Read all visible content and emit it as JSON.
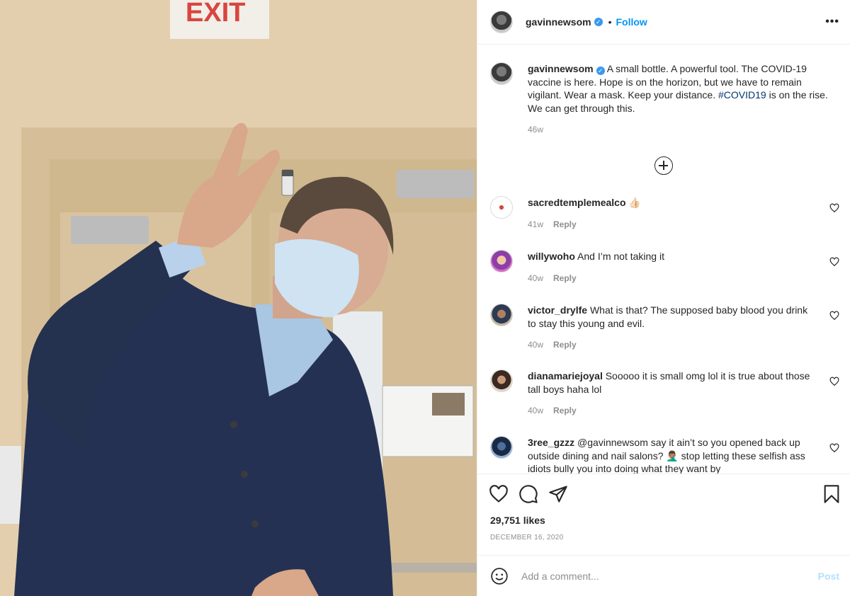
{
  "post": {
    "username": "gavinnewsom",
    "verified": true,
    "follow_label": "Follow",
    "more_label": "•••",
    "dot": "•"
  },
  "photo": {
    "exit_sign_text": "EXIT"
  },
  "caption": {
    "username": "gavinnewsom",
    "text_before": "A small bottle. A powerful tool. The COVID-19 vaccine is here. Hope is on the horizon, but we have to remain vigilant. Wear a mask. Keep your distance. ",
    "hashtag": "#COVID19",
    "text_after": " is on the rise. We can get through this.",
    "time": "46w"
  },
  "comments": [
    {
      "username": "sacredtemplemealco",
      "text": "👍🏻",
      "time": "41w",
      "reply_label": "Reply"
    },
    {
      "username": "willywoho",
      "text": "And I’m not taking it",
      "time": "40w",
      "reply_label": "Reply"
    },
    {
      "username": "victor_drylfe",
      "text": "What is that? The supposed baby blood you drink to stay this young and evil.",
      "time": "40w",
      "reply_label": "Reply"
    },
    {
      "username": "dianamariejoyal",
      "text": "Sooooo it is small omg lol it is true about those tall boys haha lol",
      "time": "40w",
      "reply_label": "Reply"
    },
    {
      "username": "3ree_gzzz",
      "text": "@gavinnewsom say it ain’t so you opened back up outside dining and nail salons? 🤦🏽‍♂️ stop letting these selfish ass idiots bully you into doing what they want by",
      "time": "",
      "reply_label": ""
    }
  ],
  "stats": {
    "likes": "29,751 likes",
    "date": "DECEMBER 16, 2020"
  },
  "comment_box": {
    "placeholder": "Add a comment...",
    "post_label": "Post"
  },
  "icons": {
    "like": "heart-icon",
    "comment": "comment-icon",
    "share": "share-icon",
    "save": "bookmark-icon",
    "emoji": "emoji-icon",
    "add": "plus-circle-icon"
  },
  "colors": {
    "link": "#0095f6",
    "hashtag": "#00376b",
    "muted": "#8e8e8e",
    "post_disabled": "#b2dffc"
  }
}
